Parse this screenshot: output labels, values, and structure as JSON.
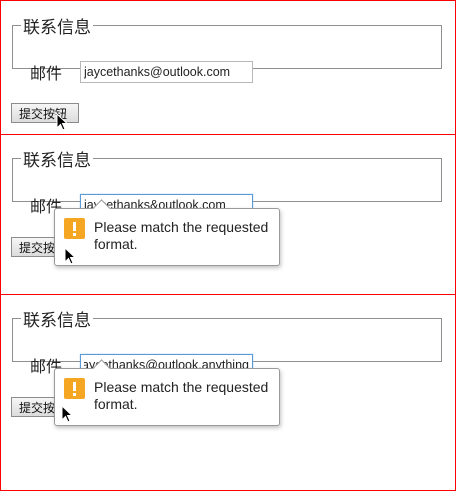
{
  "form": {
    "legend": "联系信息",
    "email_label": "邮件",
    "submit_label": "提交按钮"
  },
  "states": [
    {
      "email_value": "jaycethanks@outlook.com"
    },
    {
      "email_value": "jaycethanks&outlook.com",
      "validation_message": "Please match the requested format."
    },
    {
      "email_value": "jaycethanks@outlook.anything",
      "validation_message": "Please match the requested format."
    }
  ],
  "icons": {
    "warning": "warning-icon",
    "pointer": "mouse-pointer-icon"
  },
  "colors": {
    "frame_border": "#ff0000",
    "warning": "#f5a623",
    "focus_border": "#5b9bd5"
  }
}
